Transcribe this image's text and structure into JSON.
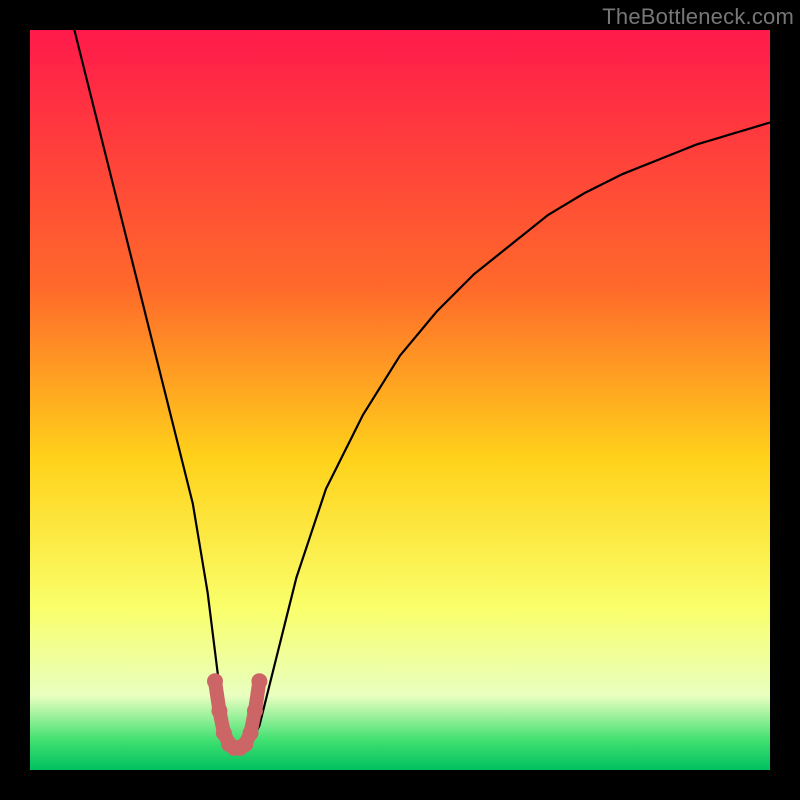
{
  "watermark": "TheBottleneck.com",
  "colors": {
    "gradient_top": "#ff1a4b",
    "gradient_mid1": "#ff6a2a",
    "gradient_mid2": "#ffd21a",
    "gradient_mid3": "#faff6a",
    "gradient_bottom1": "#e8ffc0",
    "gradient_bottom2": "#40e070",
    "gradient_bottom3": "#00c060",
    "curve": "#000000",
    "marker": "#cc6666"
  },
  "chart_data": {
    "type": "line",
    "title": "",
    "xlabel": "",
    "ylabel": "",
    "xlim": [
      0,
      100
    ],
    "ylim": [
      0,
      100
    ],
    "series": [
      {
        "name": "bottleneck-curve",
        "x": [
          6,
          8,
          10,
          12,
          14,
          16,
          18,
          20,
          22,
          24,
          25,
          26,
          27,
          28,
          29,
          30,
          31,
          32,
          34,
          36,
          40,
          45,
          50,
          55,
          60,
          65,
          70,
          75,
          80,
          85,
          90,
          95,
          100
        ],
        "y": [
          100,
          92,
          84,
          76,
          68,
          60,
          52,
          44,
          36,
          24,
          16,
          8,
          4,
          3,
          3,
          4,
          6,
          10,
          18,
          26,
          38,
          48,
          56,
          62,
          67,
          71,
          75,
          78,
          80.5,
          82.5,
          84.5,
          86,
          87.5
        ]
      }
    ],
    "markers": {
      "name": "highlight-region",
      "x": [
        25,
        25.6,
        26.2,
        26.9,
        27.6,
        28.4,
        29.1,
        29.8,
        30.4,
        31
      ],
      "y": [
        12,
        8,
        5,
        3.5,
        3,
        3,
        3.5,
        5,
        8,
        12
      ]
    }
  }
}
